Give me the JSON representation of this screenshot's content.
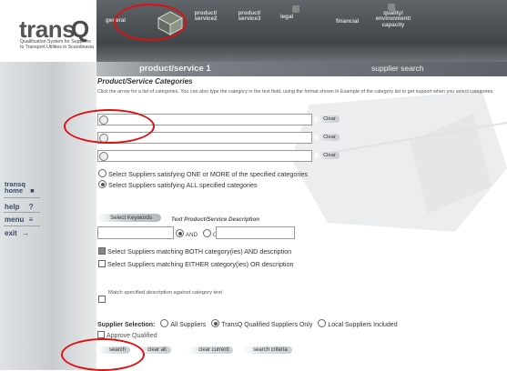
{
  "logo": {
    "word": "trans",
    "mark": "Q",
    "tagline": "Qualification System for Suppliers to Transport Utilities in Scandinavia"
  },
  "nav": {
    "general": "general",
    "ps2": "product/ service2",
    "ps3": "product/ service3",
    "legal": "legal",
    "financial": "financial",
    "quality": "quality/ environment/ capacity",
    "icon": "product-service-icon"
  },
  "section": {
    "title": "product/service 1",
    "right": "supplier search"
  },
  "sidebar": {
    "home": "transq home",
    "help": "help",
    "help_glyph": "?",
    "menu": "menu",
    "exit": "exit"
  },
  "categories": {
    "title": "Product/Service Categories",
    "desc": "Click the arrow for a list of categories. You can also type the category in the text field, using the format shown in Example of the category list to get support when you select categories.",
    "rows": [
      {
        "value": "",
        "clear": "Clear"
      },
      {
        "value": "",
        "clear": "Clear"
      },
      {
        "value": "",
        "clear": "Clear"
      }
    ],
    "opt_one": "Select Suppliers satisfying ONE or MORE of the specified categories",
    "opt_all": "Select Suppliers satisfying ALL specified categories"
  },
  "keywords": {
    "button": "Select Keywords",
    "label": "Text Product/Service Description",
    "and": "AND",
    "or": "OR",
    "both": "Select Suppliers matching BOTH category(ies) AND description",
    "either": "Select Suppliers matching EITHER category(ies) OR description",
    "match": "Match specified description against category text"
  },
  "supplier": {
    "label": "Supplier Selection:",
    "all": "All Suppliers",
    "qualified": "TransQ Qualified Suppliers Only",
    "local": "Local Suppliers Included",
    "approve": "Approve Qualified"
  },
  "actions": {
    "search": "search",
    "clear_all": "clear all",
    "clear_current": "clear current",
    "search_criteria": "search criteria"
  },
  "colors": {
    "annotation": "#e01010",
    "nav_bg": "#4a5054",
    "sidebar_bg": "#cfd3d6"
  }
}
